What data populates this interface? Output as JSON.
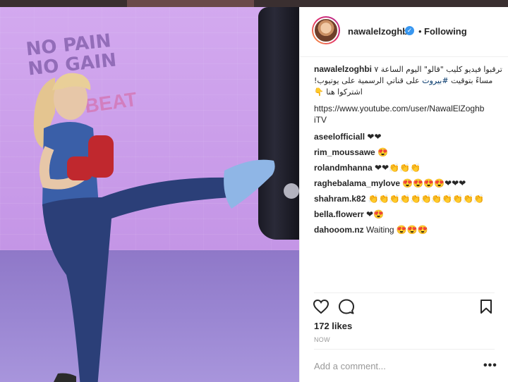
{
  "post": {
    "author": "nawalelzoghbi",
    "follow_status": "Following",
    "separator": "•",
    "verified_glyph": "✓",
    "caption_line1": "ترقبوا فيديو كليب \"قالو\" اليوم الساعة ٧",
    "caption_line2_a": "مساءً بتوقيت ",
    "caption_line2_hashtag": "#بيروت",
    "caption_line2_b": " على قناتي الرسمية على يوتيوب!",
    "caption_line3": "اشتركوا هنا 👇",
    "caption_url_1": "https://www.youtube.com/user/NawalElZoghb",
    "caption_url_2": "iTV"
  },
  "comments": [
    {
      "user": "aseelofficiall",
      "text": "❤❤"
    },
    {
      "user": "rim_moussawe",
      "text": "😍"
    },
    {
      "user": "rolandmhanna",
      "text": "❤❤👏👏👏"
    },
    {
      "user": "raghebalama_mylove",
      "text": "😍😍😍😍❤❤❤"
    },
    {
      "user": "shahram.k82",
      "text": "👏👏👏👏👏👏👏👏👏👏👏"
    },
    {
      "user": "bella.flowerr",
      "text": "❤😍"
    },
    {
      "user": "dahooom.nz",
      "text": "Waiting 😍😍😍"
    }
  ],
  "actions": {
    "likes": "172 likes",
    "timestamp": "NOW",
    "add_comment_placeholder": "Add a comment...",
    "more_glyph": "•••",
    "icons": [
      "heart-icon",
      "comment-icon",
      "bookmark-icon",
      "more-options-icon"
    ]
  },
  "photo": {
    "graffiti_text": "NO PAIN\nNO GAIN",
    "graffiti_text_2": "BEAT"
  },
  "colors": {
    "link": "#003569",
    "verified": "#3897f0",
    "muted": "#999999"
  }
}
